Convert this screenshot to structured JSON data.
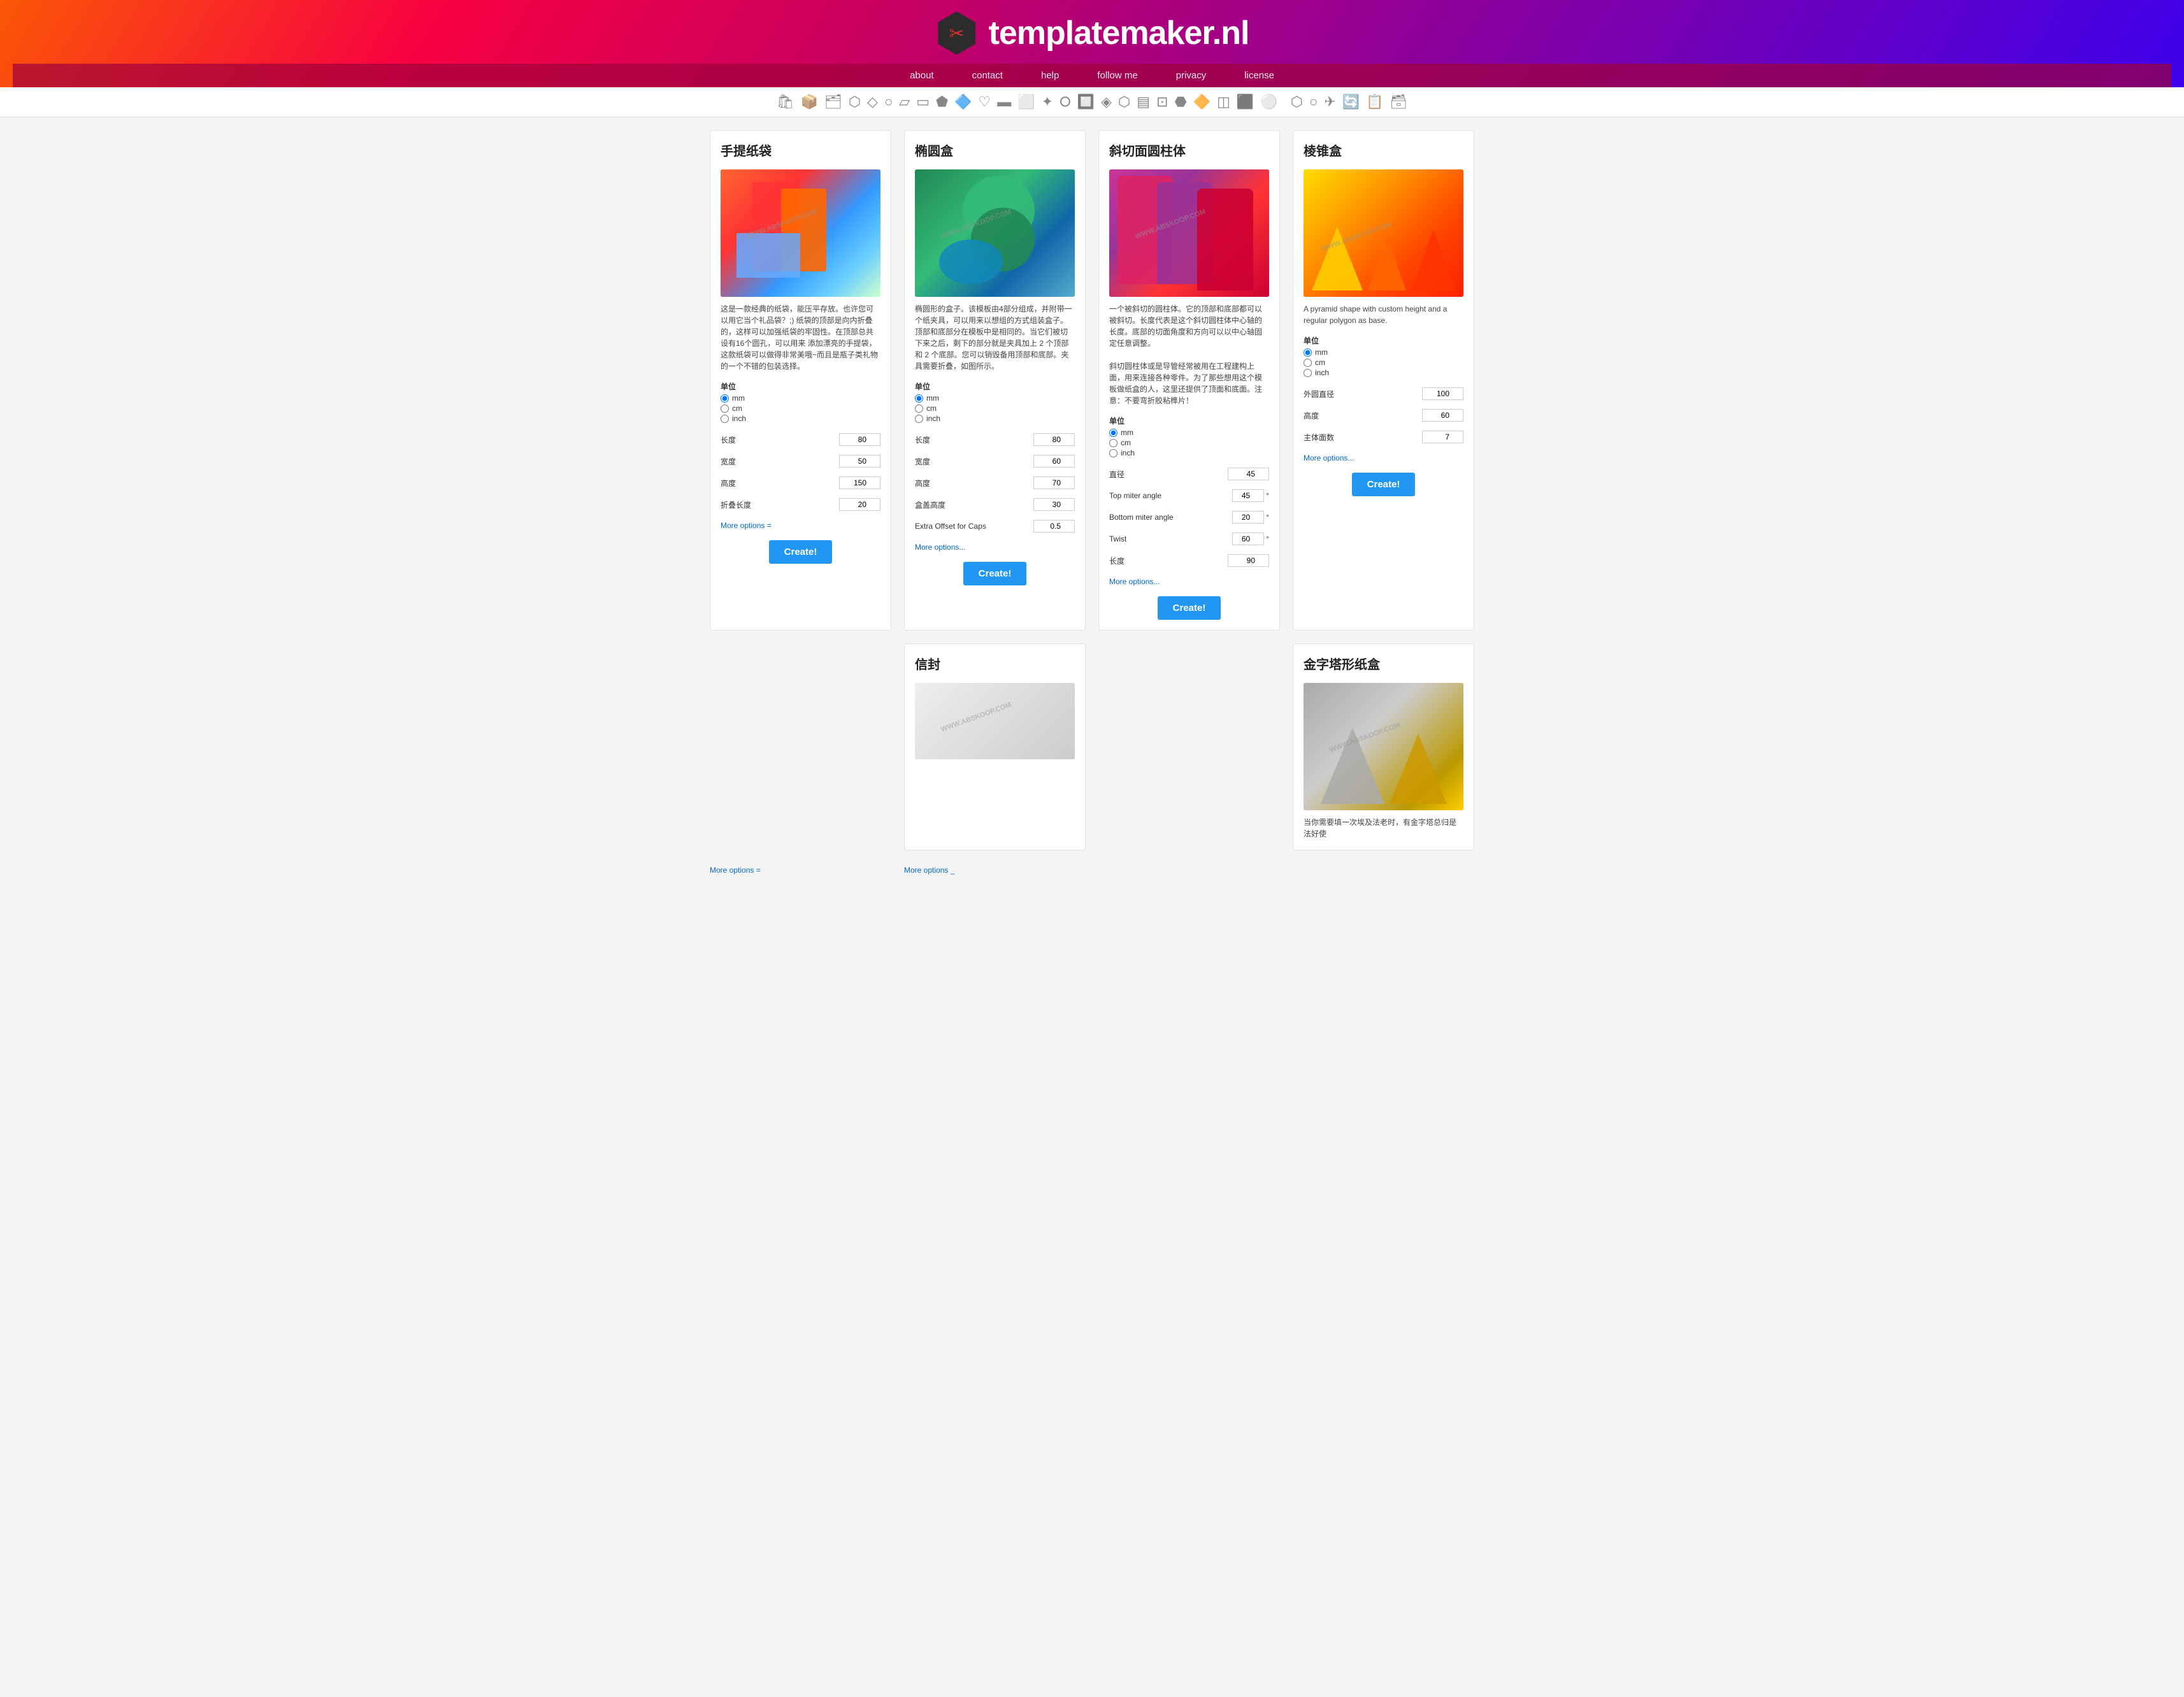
{
  "site": {
    "title": "templatemaker.nl",
    "logo_scissors": "✂",
    "nav": [
      {
        "label": "about",
        "href": "#"
      },
      {
        "label": "contact",
        "href": "#"
      },
      {
        "label": "help",
        "href": "#"
      },
      {
        "label": "follow me",
        "href": "#"
      },
      {
        "label": "privacy",
        "href": "#"
      },
      {
        "label": "license",
        "href": "#"
      }
    ]
  },
  "cards": [
    {
      "id": "handbag",
      "title": "手提纸袋",
      "desc": "这是一款经典的纸袋，能压平存放。也许您可以用它当个礼品袋？;) 纸袋的顶部是向内折叠的，这样可以加强纸袋的牢固性。在顶部总共设有16个圆孔，可以用来 添加漂亮的手提袋，这款纸袋可以做得非常美哦~而且是瓶子类礼物的一个不错的包装选择。",
      "unit_label": "单位",
      "units": [
        "mm",
        "cm",
        "inch"
      ],
      "default_unit": "mm",
      "fields": [
        {
          "label": "长度",
          "value": "80"
        },
        {
          "label": "宽度",
          "value": "50"
        },
        {
          "label": "高度",
          "value": "150"
        },
        {
          "label": "折叠长度",
          "value": "20"
        }
      ],
      "more_options": "More options...",
      "create_btn": "Create!"
    },
    {
      "id": "oval-box",
      "title": "椭圆盒",
      "desc": "椭圆形的盒子。该模板由4部分组成，并附带一个纸夹具，可以用来以想组的方式组装盒子。顶部和底部分在模板中是相同的。当它们被切下来之后，剩下的部分就是夹具加上 2 个顶部和 2 个底部。您可以销毁备用顶部和底部。夹具需要折叠，如图所示。",
      "unit_label": "单位",
      "units": [
        "mm",
        "cm",
        "inch"
      ],
      "default_unit": "mm",
      "fields": [
        {
          "label": "长度",
          "value": "80"
        },
        {
          "label": "宽度",
          "value": "60"
        },
        {
          "label": "高度",
          "value": "70"
        },
        {
          "label": "盒盖高度",
          "value": "30"
        },
        {
          "label": "Extra Offset for Caps",
          "value": "0.5"
        }
      ],
      "more_options": "More options...",
      "create_btn": "Create!"
    },
    {
      "id": "slant-cylinder",
      "title": "斜切面圆柱体",
      "desc": "一个被斜切的圆柱体。它的顶部和底部都可以被斜切。长度代表是这个斜切圆柱体中心轴的长度。底部的切面角度和方向可以以中心轴固定任意调整。\n\n斜切圆柱体或是导管经常被用在工程建构上面，用来连接各种零件。为了那些想用这个模板做纸盒的人，这里还提供了顶面和底面。注意：不要弯折胶粘榫片！",
      "unit_label": "单位",
      "units": [
        "mm",
        "cm",
        "inch"
      ],
      "default_unit": "mm",
      "fields_basic": [
        {
          "label": "直径",
          "value": "45"
        }
      ],
      "fields_degree": [
        {
          "label": "Top miter angle",
          "value": "45",
          "unit": "°"
        },
        {
          "label": "Bottom miter angle",
          "value": "20",
          "unit": "°"
        },
        {
          "label": "Twist",
          "value": "60",
          "unit": "°"
        }
      ],
      "fields_plain": [
        {
          "label": "长度",
          "value": "90"
        }
      ],
      "more_options": "More options...",
      "create_btn": "Create!"
    },
    {
      "id": "pyramid-box",
      "title": "棱锥盒",
      "desc": "A pyramid shape with custom height and a regular polygon as base.",
      "unit_label": "单位",
      "units": [
        "mm",
        "cm",
        "inch"
      ],
      "default_unit": "mm",
      "fields": [
        {
          "label": "外圆直径",
          "value": "100"
        },
        {
          "label": "高度",
          "value": "60"
        },
        {
          "label": "主体面数",
          "value": "7"
        }
      ],
      "more_options": "More options...",
      "create_btn": "Create!"
    }
  ],
  "cards_row2": [
    {
      "id": "envelope",
      "title": "信封"
    },
    {
      "id": "gold-pyramid",
      "title": "金字塔形纸盒",
      "desc": "当你需要填一次埃及法老时，有金字塔总归是法好使"
    }
  ],
  "more_options_bottom_left": "More options =",
  "more_options_bottom_mid": "More options _"
}
